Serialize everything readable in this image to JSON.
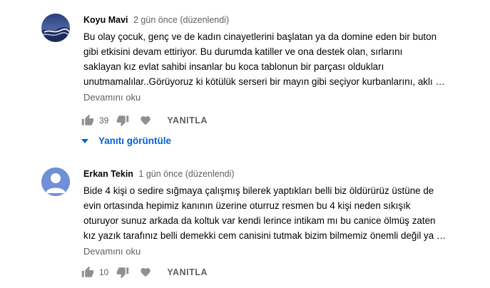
{
  "comments": [
    {
      "author": "Koyu Mavi",
      "meta": "2 gün önce (düzenlendi)",
      "lines": [
        "Bu olay çocuk, genç ve de kadın cinayetlerini başlatan ya da domine eden bir buton",
        "gibi etkisini devam ettiriyor. Bu durumda katiller ve ona destek olan,  sırlarını",
        "saklayan kız evlat sahibi insanlar bu koca tablonun bir parçası oldukları",
        "unutmamalılar..Görüyoruz ki kötülük serseri bir mayın gibi seçiyor kurbanlarını, aklı …"
      ],
      "read_more": "Devamını oku",
      "likes": "39",
      "reply": "YANITLA",
      "view_replies": "Yanıtı görüntüle"
    },
    {
      "author": "Erkan Tekin",
      "meta": "1 gün önce (düzenlendi)",
      "lines": [
        "Bide 4 kişi o sedire sığmaya çalışmış bilerek yaptıkları belli biz öldürürüz üstüne de",
        "evin ortasında hepimiz kanının üzerine oturruz resmen bu 4 kişi neden sıkışık",
        "oturuyor sunuz arkada da koltuk var kendi lerince intikam mı bu canice ölmüş zaten",
        "kız yazık tarafınız belli demekki cem canisini tutmak bizim bilmemiz önemli değil ya …"
      ],
      "read_more": "Devamını oku",
      "likes": "10",
      "reply": "YANITLA"
    }
  ],
  "colors": {
    "link_blue": "#065fd4",
    "meta_gray": "#606060",
    "icon_gray": "#909090",
    "default_avatar_bg": "#6f8fd6"
  },
  "icons": [
    "like-icon",
    "dislike-icon",
    "heart-icon",
    "chevron-down-icon"
  ]
}
